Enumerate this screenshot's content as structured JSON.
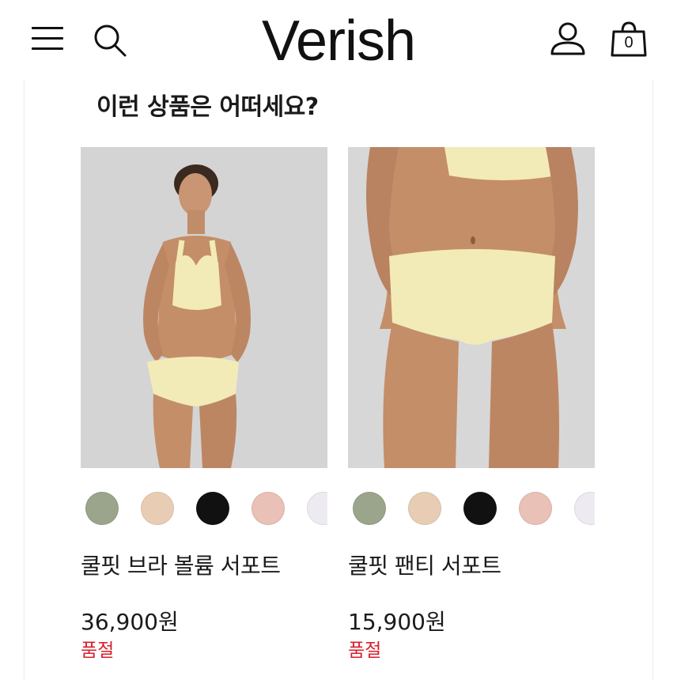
{
  "header": {
    "logo": "Verish",
    "menu_icon": "hamburger-menu-icon",
    "search_icon": "search-icon",
    "user_icon": "user-icon",
    "bag_icon": "shopping-bag-icon",
    "bag_count": "0"
  },
  "section": {
    "title": "이런 상품은 어떠세요?"
  },
  "products": [
    {
      "name": "쿨핏 브라 볼륨 서포트",
      "price": "36,900원",
      "status": "품절",
      "swatches": [
        "#9aa58b",
        "#e8cdb4",
        "#111111",
        "#e9c1b6",
        "#eeeaf2"
      ]
    },
    {
      "name": "쿨핏 팬티 서포트",
      "price": "15,900원",
      "status": "품절",
      "swatches": [
        "#9aa58b",
        "#e8cdb4",
        "#111111",
        "#e9c1b6",
        "#eeeaf2"
      ]
    }
  ],
  "colors": {
    "soldout": "#d91f2b",
    "garment": "#f3ebb7",
    "skin": "#c48e68"
  }
}
